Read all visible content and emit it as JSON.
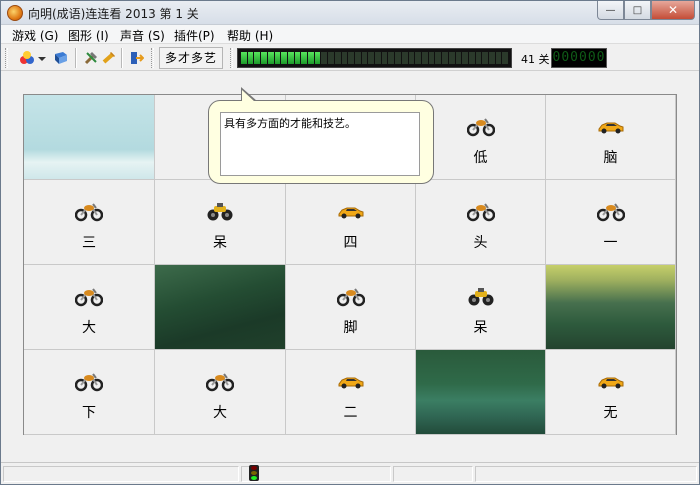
{
  "window": {
    "title": "向明(成语)连连看 2013  第 1 关",
    "buttons": {
      "minimize": "—",
      "maximize": "□",
      "close": "✕"
    }
  },
  "menu": [
    {
      "label": "游戏 (G)"
    },
    {
      "label": "图形 (I)"
    },
    {
      "label": "声音 (S)"
    },
    {
      "label": "插件(P)"
    },
    {
      "label": "帮助 (H)"
    }
  ],
  "toolbar": {
    "hint_label": "多才多艺",
    "level_label": "41 关",
    "counter": "000000",
    "progress_fraction": 0.3,
    "icons": [
      "theme-icon",
      "dropdown-arrow-icon",
      "book-icon",
      "tools-icon",
      "hammer-icon",
      "exit-icon"
    ]
  },
  "callout": {
    "text": "具有多方面的才能和技艺。"
  },
  "board": {
    "rows": [
      [
        {
          "type": "picture",
          "style": "sky"
        },
        {
          "type": "empty"
        },
        {
          "type": "empty"
        },
        {
          "type": "tile",
          "icon": "chopper",
          "char": "低"
        },
        {
          "type": "tile",
          "icon": "sportscar",
          "char": "脑"
        }
      ],
      [
        {
          "type": "tile",
          "icon": "chopper",
          "char": "三"
        },
        {
          "type": "tile",
          "icon": "atv",
          "char": "呆"
        },
        {
          "type": "tile",
          "icon": "sportscar",
          "char": "四"
        },
        {
          "type": "tile",
          "icon": "chopper",
          "char": "头"
        },
        {
          "type": "tile",
          "icon": "chopper",
          "char": "一"
        }
      ],
      [
        {
          "type": "tile",
          "icon": "chopper",
          "char": "大"
        },
        {
          "type": "picture",
          "style": "hill"
        },
        {
          "type": "tile",
          "icon": "chopper",
          "char": "脚"
        },
        {
          "type": "tile",
          "icon": "atv",
          "char": "呆"
        },
        {
          "type": "picture",
          "style": "hill2"
        }
      ],
      [
        {
          "type": "tile",
          "icon": "chopper",
          "char": "下"
        },
        {
          "type": "tile",
          "icon": "chopper",
          "char": "大"
        },
        {
          "type": "tile",
          "icon": "sportscar",
          "char": "二"
        },
        {
          "type": "picture",
          "style": "lake"
        },
        {
          "type": "tile",
          "icon": "sportscar",
          "char": "无"
        }
      ]
    ]
  },
  "colors": {
    "progress_on": "#2fc33a",
    "callout_bg": "#ffffe1",
    "title_bar": "#dfe5ec"
  }
}
